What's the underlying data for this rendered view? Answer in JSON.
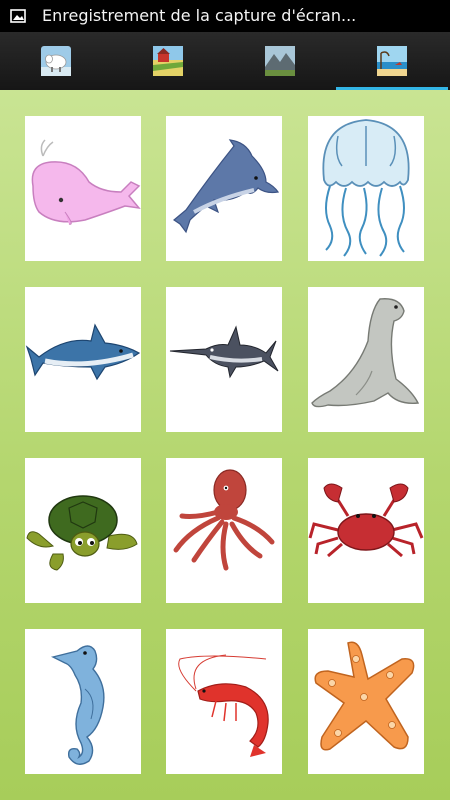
{
  "status_bar": {
    "title": "Enregistrement de la capture d'écran..."
  },
  "tabs": [
    {
      "icon": "sheep-icon",
      "selected": false
    },
    {
      "icon": "farm-icon",
      "selected": false
    },
    {
      "icon": "mountain-icon",
      "selected": false
    },
    {
      "icon": "beach-icon",
      "selected": true
    }
  ],
  "colors": {
    "accent": "#33b5e5",
    "background_top": "#c9e493",
    "background_bottom": "#a7cd5a"
  },
  "grid": {
    "items": [
      {
        "name": "whale"
      },
      {
        "name": "dolphin"
      },
      {
        "name": "jellyfish"
      },
      {
        "name": "shark"
      },
      {
        "name": "swordfish"
      },
      {
        "name": "sea-lion"
      },
      {
        "name": "turtle"
      },
      {
        "name": "octopus"
      },
      {
        "name": "crab"
      },
      {
        "name": "seahorse"
      },
      {
        "name": "shrimp"
      },
      {
        "name": "starfish"
      }
    ]
  }
}
